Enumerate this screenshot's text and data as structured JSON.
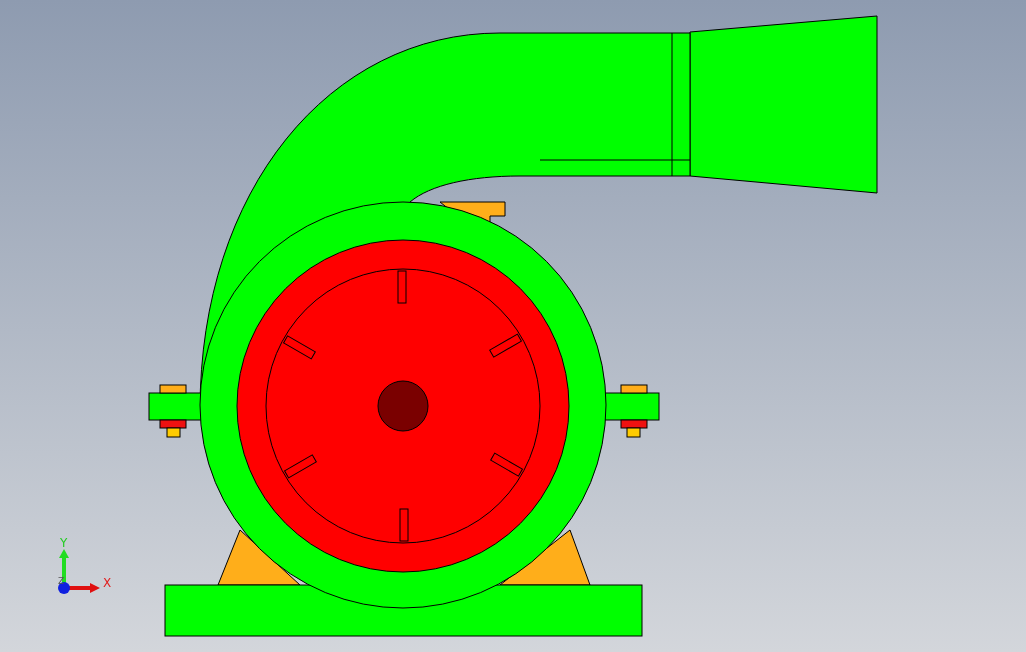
{
  "viewport": {
    "axis_labels": [
      "Y",
      "Z",
      "X"
    ]
  }
}
